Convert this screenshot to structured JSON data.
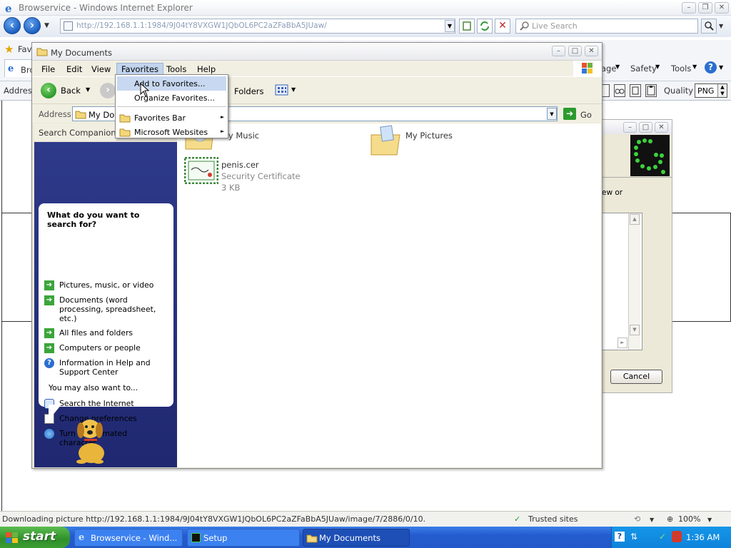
{
  "ie": {
    "title": "Browservice - Windows Internet Explorer",
    "address": "http://192.168.1.1:1984/9J04tY8VXGW1JQbOL6PC2aZFaBbA5JUaw/",
    "live_search": "Live Search",
    "fav_tab": "Fav",
    "tab_partial": "Bro",
    "page_label": "age",
    "safety": "Safety",
    "tools": "Tools",
    "address_label": "Address",
    "quality_label": "Quality",
    "quality_value": "PNG",
    "status_text": "Downloading picture http://192.168.1.1:1984/9J04tY8VXGW1JQbOL6PC2aZFaBbA5JUaw/image/7/2886/0/10.",
    "zone": "Trusted sites",
    "zoom": "100%"
  },
  "dialog": {
    "partial_text": "ew or",
    "cancel": "Cancel"
  },
  "mydocs": {
    "title": "My Documents",
    "menu": [
      "File",
      "Edit",
      "View",
      "Favorites",
      "Tools",
      "Help"
    ],
    "back": "Back",
    "folders": "Folders",
    "address_label": "Address",
    "address_value": "My Doc",
    "go": "Go",
    "search_companion": "Search Companion",
    "files": [
      {
        "name": "My Music"
      },
      {
        "name": "My Pictures"
      },
      {
        "name": "penis.cer",
        "type": "Security Certificate",
        "size": "3 KB"
      }
    ],
    "search": {
      "heading": "What do you want to search for?",
      "options": [
        "Pictures, music, or video",
        "Documents (word processing, spreadsheet, etc.)",
        "All files and folders",
        "Computers or people",
        "Information in Help and Support Center"
      ],
      "also": "You may also want to...",
      "also_options": [
        "Search the Internet",
        "Change preferences",
        "Turn off animated character"
      ]
    }
  },
  "favorites_menu": {
    "items": [
      "Add to Favorites...",
      "Organize Favorites...",
      "Favorites Bar",
      "Microsoft Websites"
    ]
  },
  "taskbar": {
    "start": "start",
    "tasks": [
      "Browservice - Wind...",
      "Setup",
      "My Documents"
    ],
    "time": "1:36 AM"
  },
  "colors": {
    "xp_blue": "#245ccf",
    "start_green": "#2f8f2a",
    "menu_highlight": "#c8d8f0"
  }
}
